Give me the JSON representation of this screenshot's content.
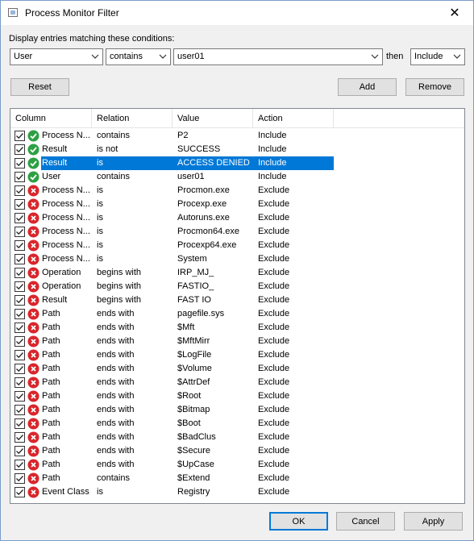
{
  "window": {
    "title": "Process Monitor Filter",
    "close_glyph": "✕"
  },
  "condition": {
    "label": "Display entries matching these conditions:",
    "column_value": "User",
    "relation_value": "contains",
    "value_value": "user01",
    "then_label": "then",
    "action_value": "Include"
  },
  "buttons": {
    "reset": "Reset",
    "add": "Add",
    "remove": "Remove",
    "ok": "OK",
    "cancel": "Cancel",
    "apply": "Apply"
  },
  "list": {
    "headers": [
      "Column",
      "Relation",
      "Value",
      "Action"
    ],
    "rows": [
      {
        "column": "Process N...",
        "relation": "contains",
        "value": "P2",
        "action": "Include",
        "include": true,
        "checked": true,
        "selected": false
      },
      {
        "column": "Result",
        "relation": "is not",
        "value": "SUCCESS",
        "action": "Include",
        "include": true,
        "checked": true,
        "selected": false
      },
      {
        "column": "Result",
        "relation": "is",
        "value": "ACCESS DENIED",
        "action": "Include",
        "include": true,
        "checked": true,
        "selected": true
      },
      {
        "column": "User",
        "relation": "contains",
        "value": "user01",
        "action": "Include",
        "include": true,
        "checked": true,
        "selected": false
      },
      {
        "column": "Process N...",
        "relation": "is",
        "value": "Procmon.exe",
        "action": "Exclude",
        "include": false,
        "checked": true,
        "selected": false
      },
      {
        "column": "Process N...",
        "relation": "is",
        "value": "Procexp.exe",
        "action": "Exclude",
        "include": false,
        "checked": true,
        "selected": false
      },
      {
        "column": "Process N...",
        "relation": "is",
        "value": "Autoruns.exe",
        "action": "Exclude",
        "include": false,
        "checked": true,
        "selected": false
      },
      {
        "column": "Process N...",
        "relation": "is",
        "value": "Procmon64.exe",
        "action": "Exclude",
        "include": false,
        "checked": true,
        "selected": false
      },
      {
        "column": "Process N...",
        "relation": "is",
        "value": "Procexp64.exe",
        "action": "Exclude",
        "include": false,
        "checked": true,
        "selected": false
      },
      {
        "column": "Process N...",
        "relation": "is",
        "value": "System",
        "action": "Exclude",
        "include": false,
        "checked": true,
        "selected": false
      },
      {
        "column": "Operation",
        "relation": "begins with",
        "value": "IRP_MJ_",
        "action": "Exclude",
        "include": false,
        "checked": true,
        "selected": false
      },
      {
        "column": "Operation",
        "relation": "begins with",
        "value": "FASTIO_",
        "action": "Exclude",
        "include": false,
        "checked": true,
        "selected": false
      },
      {
        "column": "Result",
        "relation": "begins with",
        "value": "FAST IO",
        "action": "Exclude",
        "include": false,
        "checked": true,
        "selected": false
      },
      {
        "column": "Path",
        "relation": "ends with",
        "value": "pagefile.sys",
        "action": "Exclude",
        "include": false,
        "checked": true,
        "selected": false
      },
      {
        "column": "Path",
        "relation": "ends with",
        "value": "$Mft",
        "action": "Exclude",
        "include": false,
        "checked": true,
        "selected": false
      },
      {
        "column": "Path",
        "relation": "ends with",
        "value": "$MftMirr",
        "action": "Exclude",
        "include": false,
        "checked": true,
        "selected": false
      },
      {
        "column": "Path",
        "relation": "ends with",
        "value": "$LogFile",
        "action": "Exclude",
        "include": false,
        "checked": true,
        "selected": false
      },
      {
        "column": "Path",
        "relation": "ends with",
        "value": "$Volume",
        "action": "Exclude",
        "include": false,
        "checked": true,
        "selected": false
      },
      {
        "column": "Path",
        "relation": "ends with",
        "value": "$AttrDef",
        "action": "Exclude",
        "include": false,
        "checked": true,
        "selected": false
      },
      {
        "column": "Path",
        "relation": "ends with",
        "value": "$Root",
        "action": "Exclude",
        "include": false,
        "checked": true,
        "selected": false
      },
      {
        "column": "Path",
        "relation": "ends with",
        "value": "$Bitmap",
        "action": "Exclude",
        "include": false,
        "checked": true,
        "selected": false
      },
      {
        "column": "Path",
        "relation": "ends with",
        "value": "$Boot",
        "action": "Exclude",
        "include": false,
        "checked": true,
        "selected": false
      },
      {
        "column": "Path",
        "relation": "ends with",
        "value": "$BadClus",
        "action": "Exclude",
        "include": false,
        "checked": true,
        "selected": false
      },
      {
        "column": "Path",
        "relation": "ends with",
        "value": "$Secure",
        "action": "Exclude",
        "include": false,
        "checked": true,
        "selected": false
      },
      {
        "column": "Path",
        "relation": "ends with",
        "value": "$UpCase",
        "action": "Exclude",
        "include": false,
        "checked": true,
        "selected": false
      },
      {
        "column": "Path",
        "relation": "contains",
        "value": "$Extend",
        "action": "Exclude",
        "include": false,
        "checked": true,
        "selected": false
      },
      {
        "column": "Event Class",
        "relation": "is",
        "value": "Registry",
        "action": "Exclude",
        "include": false,
        "checked": true,
        "selected": false
      }
    ]
  },
  "icons": {
    "include": "green-check-circle-icon",
    "exclude": "red-x-circle-icon",
    "checkbox": "checkbox-checked-icon",
    "dropdown": "chevron-down-icon",
    "app": "window-icon"
  },
  "colors": {
    "include_green": "#2ea043",
    "exclude_red": "#d9262b",
    "selection_blue": "#0078d7"
  }
}
